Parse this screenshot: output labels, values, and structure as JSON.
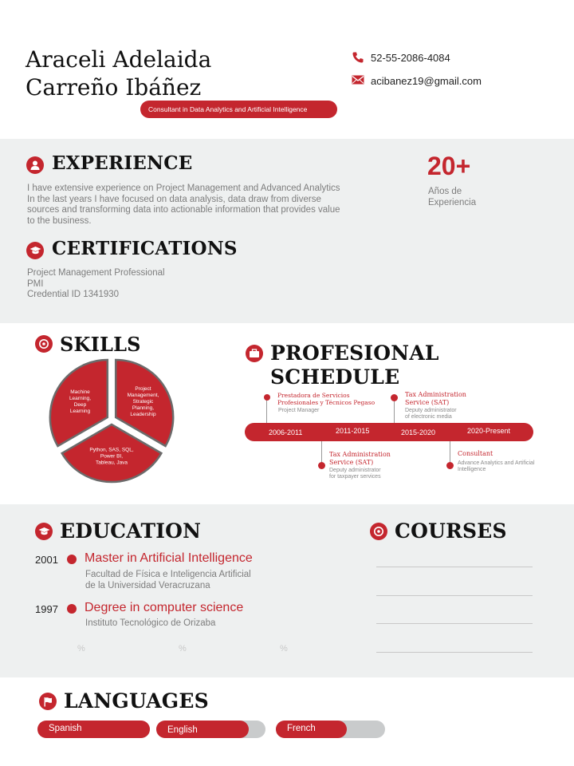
{
  "header": {
    "name_line1": "Araceli Adelaida",
    "name_line2": "Carreño Ibáñez",
    "tagline": "Consultant in Data Analytics and Artificial Intelligence",
    "phone": "52-55-2086-4084",
    "email": "acibanez19@gmail.com"
  },
  "experience": {
    "title": "EXPERIENCE",
    "text_lines": [
      "I have extensive experience on Project Management and Advanced Analytics",
      "In the last years I have focused on data analysis, data draw from diverse",
      "sources and transforming data into actionable information that provides value",
      "to the business."
    ],
    "years_value": "20+",
    "years_label_line1": "Años de",
    "years_label_line2": "Experiencia"
  },
  "certifications": {
    "title": "CERTIFICATIONS",
    "items": [
      "Project Management Professional",
      "PMI",
      "Credential ID 1341930"
    ]
  },
  "skills": {
    "title": "SKILLS",
    "color": "#c4262e",
    "segments": [
      {
        "label_lines": [
          "Project",
          "Management,",
          "Strategic",
          "Planning,",
          "Leadership"
        ],
        "share": 0.3333
      },
      {
        "label_lines": [
          "Python, SAS, SQL,",
          "Power BI,",
          "Tableau, Java"
        ],
        "share": 0.3333
      },
      {
        "label_lines": [
          "Machine",
          "Learning,",
          "Deep",
          "Learning"
        ],
        "share": 0.3334
      }
    ]
  },
  "schedule": {
    "title_line1": "PROFESIONAL",
    "title_line2": "SCHEDULE",
    "periods": [
      "2006-2011",
      "2011-2015",
      "2015-2020",
      "2020-Present"
    ],
    "events": [
      {
        "title_lines": [
          "Prestadora de Servicios",
          "Profesionales y Técnicos Pegaso"
        ],
        "sub_lines": [
          "Project Manager"
        ]
      },
      {
        "title_lines": [
          "Tax Administration",
          "Service (SAT)"
        ],
        "sub_lines": [
          "Deputy administrator",
          "for taxpayer services"
        ]
      },
      {
        "title_lines": [
          "Tax Administration",
          "Service (SAT)"
        ],
        "sub_lines": [
          "Deputy administrator",
          "of electronic media"
        ]
      },
      {
        "title_lines": [
          "Consultant"
        ],
        "sub_lines": [
          "Advance Analytics and Artificial",
          "Intelligence"
        ]
      }
    ]
  },
  "education": {
    "title": "EDUCATION",
    "items": [
      {
        "year": "2001",
        "degree": "Master in Artificial Intelligence",
        "school_lines": [
          "Facultad de Física e Inteligencia Artificial",
          "de la Universidad Veracruzana"
        ]
      },
      {
        "year": "1997",
        "degree": "Degree in computer science",
        "school_lines": [
          "Instituto Tecnológico de Orizaba"
        ]
      }
    ],
    "percent_marks": [
      "%",
      "%",
      "%"
    ]
  },
  "courses": {
    "title": "COURSES"
  },
  "languages": {
    "title": "LANGUAGES",
    "items": [
      {
        "name": "Spanish",
        "level": 1.0
      },
      {
        "name": "English",
        "level": 0.85
      },
      {
        "name": "French",
        "level": 0.65
      }
    ]
  }
}
